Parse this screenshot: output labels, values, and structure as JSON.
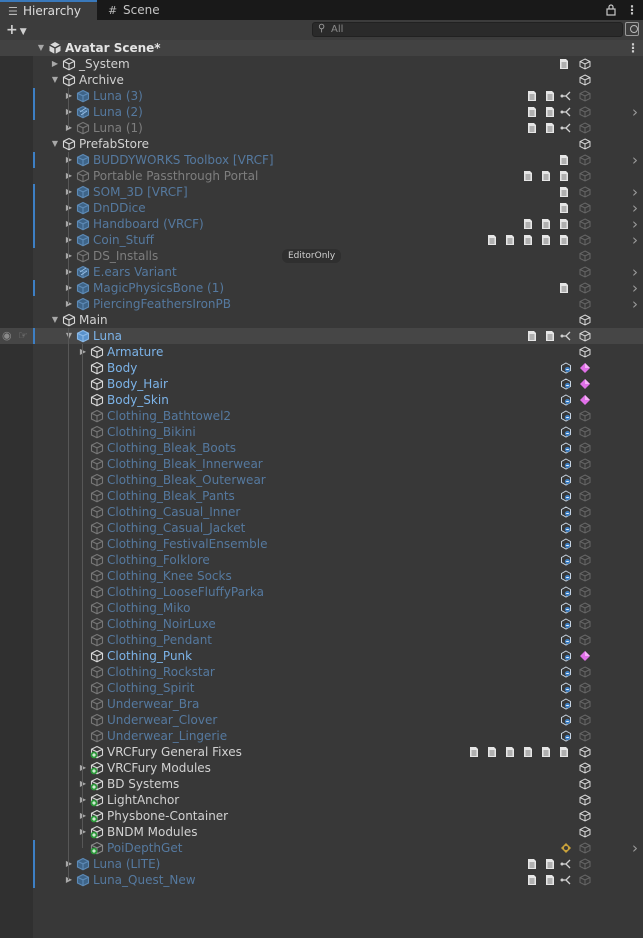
{
  "tabs": [
    {
      "label": "Hierarchy",
      "icon": "list-icon",
      "active": true
    },
    {
      "label": "Scene",
      "icon": "grid-icon",
      "active": false
    }
  ],
  "toolbar": {
    "add_label": "+",
    "search_placeholder": "All"
  },
  "colors": {
    "background": "#383838",
    "text_default": "#d2d2d2",
    "text_prefab": "#7cb3e8",
    "text_prefab_inactive": "#55799f",
    "text_inactive": "#7e7e7e",
    "accent_blue": "#3d7fc4",
    "mesh_marker": "#e070e8"
  },
  "rows": [
    {
      "name": "Avatar Scene*",
      "depth": 0,
      "kind": "scene",
      "expanded": true
    },
    {
      "name": "_System",
      "depth": 1,
      "kind": "go",
      "arrow": "right",
      "comps": [
        "script"
      ],
      "right": "cube"
    },
    {
      "name": "Archive",
      "depth": 1,
      "kind": "go",
      "arrow": "down",
      "comps": [],
      "right": "cube"
    },
    {
      "name": "Luna (3)",
      "depth": 2,
      "kind": "prefab",
      "inactive": true,
      "arrow": "right",
      "blue": true,
      "comps": [
        "script",
        "script",
        "fork"
      ],
      "right": "cube-dim"
    },
    {
      "name": "Luna (2)",
      "depth": 2,
      "kind": "prefab-variant",
      "inactive": true,
      "arrow": "right",
      "blue": true,
      "comps": [
        "script",
        "script",
        "fork"
      ],
      "right": "cube-dim",
      "chevron": true
    },
    {
      "name": "Luna (1)",
      "depth": 2,
      "kind": "go",
      "inactive": true,
      "arrow": "right",
      "comps": [
        "script",
        "script",
        "fork"
      ],
      "right": "cube-dim"
    },
    {
      "name": "PrefabStore",
      "depth": 1,
      "kind": "go",
      "arrow": "down",
      "comps": [],
      "right": "cube"
    },
    {
      "name": "BUDDYWORKS Toolbox [VRCF]",
      "depth": 2,
      "kind": "prefab",
      "inactive": true,
      "arrow": "right",
      "blue": true,
      "comps": [
        "script"
      ],
      "right": "cube-dim",
      "chevron": true
    },
    {
      "name": "Portable Passthrough Portal",
      "depth": 2,
      "kind": "go",
      "inactive": true,
      "arrow": "right",
      "comps": [
        "script",
        "script",
        "script"
      ],
      "right": "cube-dim"
    },
    {
      "name": "SOM_3D [VRCF]",
      "depth": 2,
      "kind": "prefab",
      "inactive": true,
      "arrow": "right",
      "blue": true,
      "comps": [
        "script"
      ],
      "right": "cube-dim",
      "chevron": true
    },
    {
      "name": "DnDDice",
      "depth": 2,
      "kind": "prefab",
      "inactive": true,
      "arrow": "right",
      "blue": true,
      "comps": [
        "script"
      ],
      "right": "cube-dim",
      "chevron": true
    },
    {
      "name": "Handboard (VRCF)",
      "depth": 2,
      "kind": "prefab",
      "inactive": true,
      "arrow": "right",
      "blue": true,
      "comps": [
        "script",
        "script",
        "script"
      ],
      "right": "cube-dim",
      "chevron": true
    },
    {
      "name": "Coin_Stuff",
      "depth": 2,
      "kind": "prefab",
      "inactive": true,
      "arrow": "right",
      "blue": true,
      "comps": [
        "script",
        "script",
        "script",
        "script",
        "script"
      ],
      "right": "cube-dim",
      "chevron": true
    },
    {
      "name": "DS_Installs",
      "depth": 2,
      "kind": "go",
      "inactive": true,
      "arrow": "right",
      "comps": [],
      "right": "cube-dim",
      "badge": "EditorOnly"
    },
    {
      "name": "E.ears Variant",
      "depth": 2,
      "kind": "prefab-variant",
      "inactive": true,
      "arrow": "right",
      "comps": [],
      "right": "cube-dim",
      "chevron": true
    },
    {
      "name": "MagicPhysicsBone (1)",
      "depth": 2,
      "kind": "prefab",
      "inactive": true,
      "arrow": "right",
      "blue": true,
      "comps": [
        "script"
      ],
      "right": "cube-dim",
      "chevron": true
    },
    {
      "name": "PiercingFeathersIronPB",
      "depth": 2,
      "kind": "prefab",
      "inactive": true,
      "arrow": "right",
      "comps": [],
      "right": "cube-dim",
      "chevron": true
    },
    {
      "name": "Main",
      "depth": 1,
      "kind": "go",
      "arrow": "down",
      "comps": [],
      "right": "cube"
    },
    {
      "name": "Luna",
      "depth": 2,
      "kind": "prefab",
      "arrow": "down",
      "blue": true,
      "selected": true,
      "eye": true,
      "comps": [
        "script",
        "script",
        "fork"
      ],
      "right": "cube"
    },
    {
      "name": "Armature",
      "depth": 3,
      "kind": "go",
      "prefabText": true,
      "arrow": "right",
      "comps": [],
      "right": "cube"
    },
    {
      "name": "Body",
      "depth": 3,
      "kind": "go",
      "prefabText": true,
      "comps": [
        "mesh"
      ],
      "right": "diamond"
    },
    {
      "name": "Body_Hair",
      "depth": 3,
      "kind": "go",
      "prefabText": true,
      "comps": [
        "mesh"
      ],
      "right": "diamond"
    },
    {
      "name": "Body_Skin",
      "depth": 3,
      "kind": "go",
      "prefabText": true,
      "comps": [
        "mesh"
      ],
      "right": "diamond"
    },
    {
      "name": "Clothing_Bathtowel2",
      "depth": 3,
      "kind": "go",
      "prefabText": true,
      "inactive": true,
      "comps": [
        "mesh"
      ],
      "right": "cube-dim"
    },
    {
      "name": "Clothing_Bikini",
      "depth": 3,
      "kind": "go",
      "prefabText": true,
      "inactive": true,
      "comps": [
        "mesh"
      ],
      "right": "cube-dim"
    },
    {
      "name": "Clothing_Bleak_Boots",
      "depth": 3,
      "kind": "go",
      "prefabText": true,
      "inactive": true,
      "comps": [
        "mesh"
      ],
      "right": "cube-dim"
    },
    {
      "name": "Clothing_Bleak_Innerwear",
      "depth": 3,
      "kind": "go",
      "prefabText": true,
      "inactive": true,
      "comps": [
        "mesh"
      ],
      "right": "cube-dim"
    },
    {
      "name": "Clothing_Bleak_Outerwear",
      "depth": 3,
      "kind": "go",
      "prefabText": true,
      "inactive": true,
      "comps": [
        "mesh"
      ],
      "right": "cube-dim"
    },
    {
      "name": "Clothing_Bleak_Pants",
      "depth": 3,
      "kind": "go",
      "prefabText": true,
      "inactive": true,
      "comps": [
        "mesh"
      ],
      "right": "cube-dim"
    },
    {
      "name": "Clothing_Casual_Inner",
      "depth": 3,
      "kind": "go",
      "prefabText": true,
      "inactive": true,
      "comps": [
        "mesh"
      ],
      "right": "cube-dim"
    },
    {
      "name": "Clothing_Casual_Jacket",
      "depth": 3,
      "kind": "go",
      "prefabText": true,
      "inactive": true,
      "comps": [
        "mesh"
      ],
      "right": "cube-dim"
    },
    {
      "name": "Clothing_FestivalEnsemble",
      "depth": 3,
      "kind": "go",
      "prefabText": true,
      "inactive": true,
      "comps": [
        "mesh"
      ],
      "right": "cube-dim"
    },
    {
      "name": "Clothing_Folklore",
      "depth": 3,
      "kind": "go",
      "prefabText": true,
      "inactive": true,
      "comps": [
        "mesh"
      ],
      "right": "cube-dim"
    },
    {
      "name": "Clothing_Knee Socks",
      "depth": 3,
      "kind": "go",
      "prefabText": true,
      "inactive": true,
      "comps": [
        "mesh"
      ],
      "right": "cube-dim"
    },
    {
      "name": "Clothing_LooseFluffyParka",
      "depth": 3,
      "kind": "go",
      "prefabText": true,
      "inactive": true,
      "comps": [
        "mesh"
      ],
      "right": "cube-dim"
    },
    {
      "name": "Clothing_Miko",
      "depth": 3,
      "kind": "go",
      "prefabText": true,
      "inactive": true,
      "comps": [
        "mesh"
      ],
      "right": "cube-dim"
    },
    {
      "name": "Clothing_NoirLuxe",
      "depth": 3,
      "kind": "go",
      "prefabText": true,
      "inactive": true,
      "comps": [
        "mesh"
      ],
      "right": "cube-dim"
    },
    {
      "name": "Clothing_Pendant",
      "depth": 3,
      "kind": "go",
      "prefabText": true,
      "inactive": true,
      "comps": [
        "mesh"
      ],
      "right": "cube-dim"
    },
    {
      "name": "Clothing_Punk",
      "depth": 3,
      "kind": "go",
      "prefabText": true,
      "comps": [
        "mesh"
      ],
      "right": "diamond"
    },
    {
      "name": "Clothing_Rockstar",
      "depth": 3,
      "kind": "go",
      "prefabText": true,
      "inactive": true,
      "comps": [
        "mesh"
      ],
      "right": "cube-dim"
    },
    {
      "name": "Clothing_Spirit",
      "depth": 3,
      "kind": "go",
      "prefabText": true,
      "inactive": true,
      "comps": [
        "mesh"
      ],
      "right": "cube-dim"
    },
    {
      "name": "Underwear_Bra",
      "depth": 3,
      "kind": "go",
      "prefabText": true,
      "inactive": true,
      "comps": [
        "mesh"
      ],
      "right": "cube-dim"
    },
    {
      "name": "Underwear_Clover",
      "depth": 3,
      "kind": "go",
      "prefabText": true,
      "inactive": true,
      "comps": [
        "mesh"
      ],
      "right": "cube-dim"
    },
    {
      "name": "Underwear_Lingerie",
      "depth": 3,
      "kind": "go",
      "prefabText": true,
      "inactive": true,
      "comps": [
        "mesh"
      ],
      "right": "cube-dim"
    },
    {
      "name": "VRCFury General Fixes",
      "depth": 3,
      "kind": "added",
      "comps": [
        "script",
        "script",
        "script",
        "script",
        "script",
        "script"
      ],
      "right": "cube"
    },
    {
      "name": "VRCFury Modules",
      "depth": 3,
      "kind": "added",
      "arrow": "right",
      "comps": [],
      "right": "cube"
    },
    {
      "name": "BD Systems",
      "depth": 3,
      "kind": "added",
      "arrow": "right",
      "comps": [],
      "right": "cube"
    },
    {
      "name": "LightAnchor",
      "depth": 3,
      "kind": "added",
      "arrow": "right",
      "comps": [],
      "right": "cube"
    },
    {
      "name": "Physbone-Container",
      "depth": 3,
      "kind": "added",
      "arrow": "right",
      "comps": [],
      "right": "cube"
    },
    {
      "name": "BNDM Modules",
      "depth": 3,
      "kind": "added",
      "arrow": "right",
      "comps": [],
      "right": "cube"
    },
    {
      "name": "PoiDepthGet",
      "depth": 3,
      "kind": "added-dim",
      "prefabText": true,
      "inactive": true,
      "blue": true,
      "comps": [
        "light"
      ],
      "right": "cube-dim",
      "chevron": true
    },
    {
      "name": "Luna (LITE)",
      "depth": 2,
      "kind": "prefab",
      "inactive": true,
      "arrow": "right",
      "blue": true,
      "comps": [
        "script",
        "script",
        "fork"
      ],
      "right": "cube-dim"
    },
    {
      "name": "Luna_Quest_New",
      "depth": 2,
      "kind": "prefab",
      "inactive": true,
      "arrow": "right",
      "blue": true,
      "comps": [
        "script",
        "script",
        "fork"
      ],
      "right": "cube-dim"
    }
  ]
}
